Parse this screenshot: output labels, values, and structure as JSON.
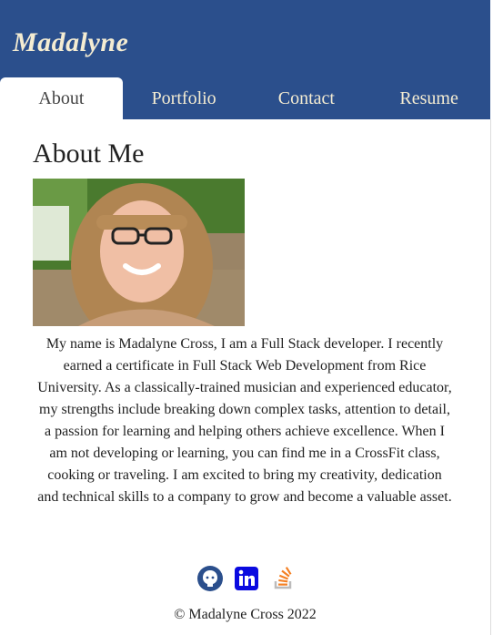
{
  "brand": {
    "name": "Madalyne"
  },
  "nav": {
    "tabs": [
      {
        "label": "About",
        "active": true
      },
      {
        "label": "Portfolio",
        "active": false
      },
      {
        "label": "Contact",
        "active": false
      },
      {
        "label": "Resume",
        "active": false
      }
    ]
  },
  "about": {
    "title": "About Me",
    "bio": "My name is Madalyne Cross, I am a Full Stack developer. I recently earned a certificate in Full Stack Web Development from Rice University. As a classically-trained musician and experienced educator, my strengths include breaking down complex tasks, attention to detail, a passion for learning and helping others achieve excellence. When I am not developing or learning, you can find me in a CrossFit class, cooking or traveling. I am excited to bring my creativity, dedication and technical skills to a company to grow and become a valuable asset."
  },
  "socials": [
    {
      "icon": "github-icon"
    },
    {
      "icon": "linkedin-icon"
    },
    {
      "icon": "stackoverflow-icon"
    }
  ],
  "footer": {
    "text": "© Madalyne Cross 2022"
  },
  "colors": {
    "header": "#2b4f8c",
    "brand_text": "#f4ecd2",
    "active_tab": "#ffffff",
    "linkedin": "#0a0ae0",
    "stackoverflow": "#f48024"
  }
}
